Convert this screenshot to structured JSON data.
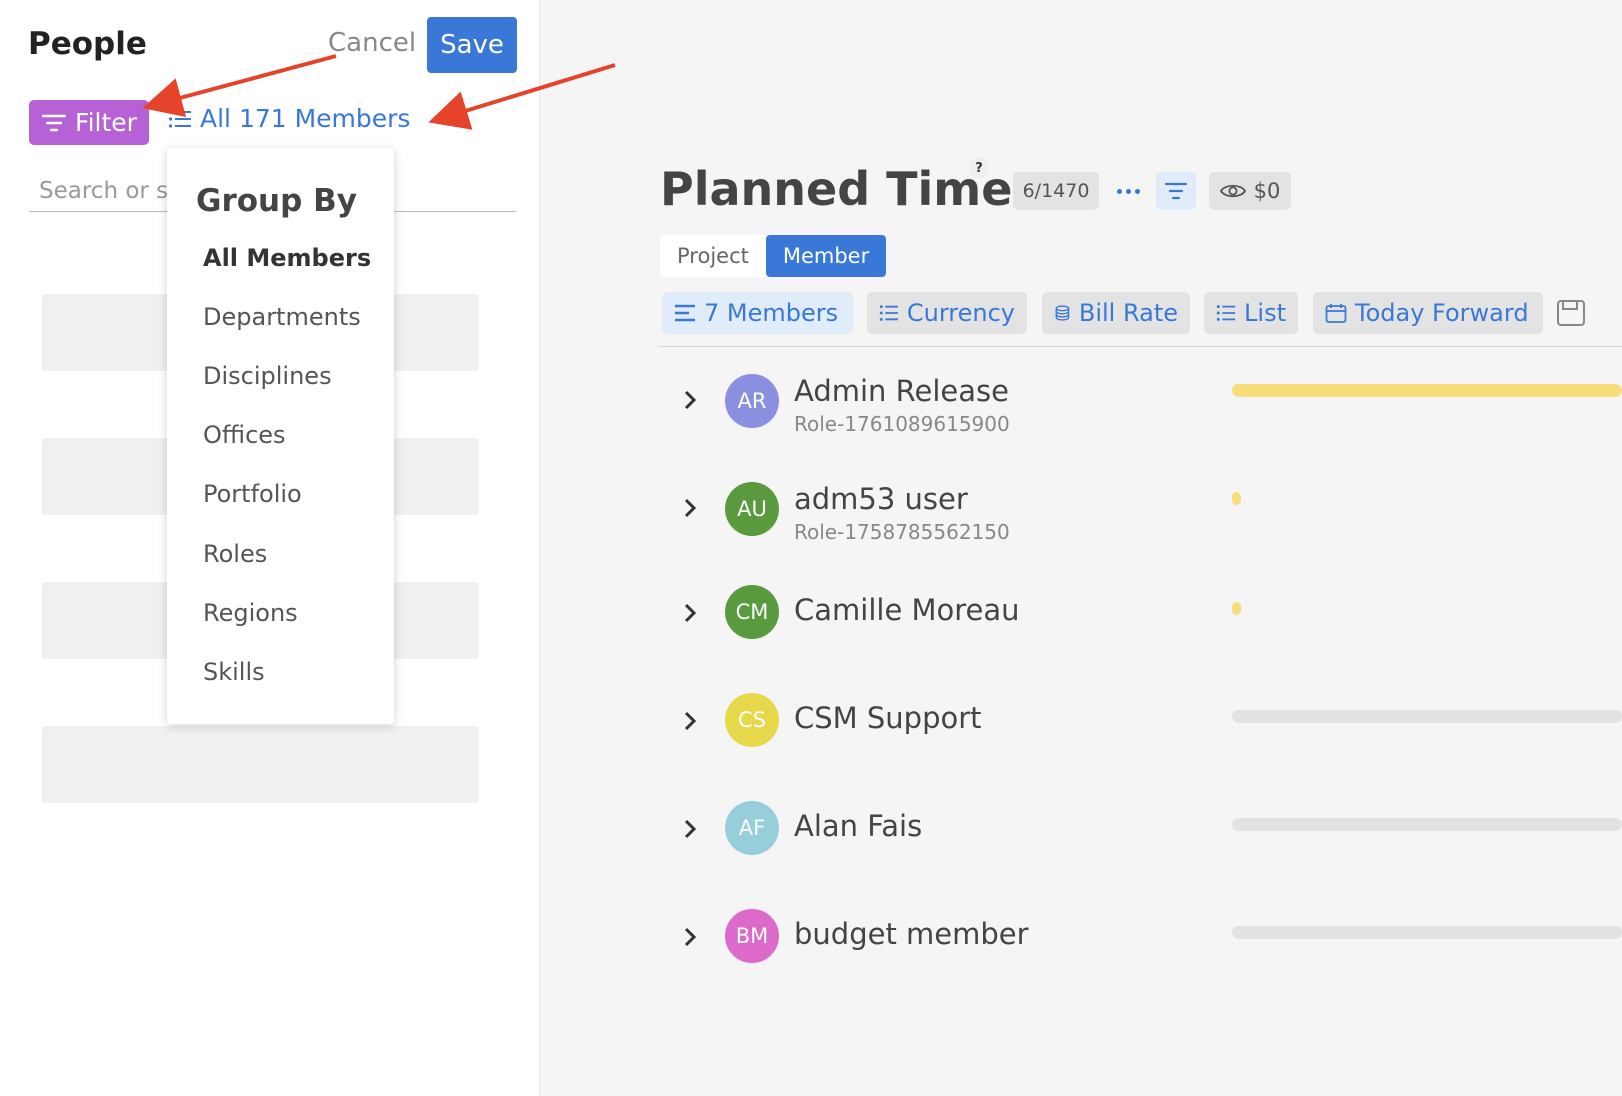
{
  "left_panel": {
    "title": "People",
    "cancel_label": "Cancel",
    "save_label": "Save",
    "filter_label": "Filter",
    "members_label": "All 171 Members",
    "search_placeholder": "Search or se"
  },
  "group_by": {
    "title": "Group By",
    "items": [
      "All Members",
      "Departments",
      "Disciplines",
      "Offices",
      "Portfolio",
      "Roles",
      "Regions",
      "Skills"
    ],
    "selected": "All Members"
  },
  "main": {
    "title": "Planned Time",
    "help": "?",
    "count": "6/1470",
    "cost": "$0",
    "tabs": [
      "Project",
      "Member"
    ],
    "active_tab": "Member",
    "toolbar": {
      "members": "7 Members",
      "currency": "Currency",
      "bill_rate": "Bill Rate",
      "list": "List",
      "today_forward": "Today Forward"
    }
  },
  "members": [
    {
      "initials": "AR",
      "name": "Admin Release",
      "role": "Role-1761089615900",
      "color": "#8a8fe0"
    },
    {
      "initials": "AU",
      "name": "adm53 user",
      "role": "Role-1758785562150",
      "color": "#5a9a3e"
    },
    {
      "initials": "CM",
      "name": "Camille Moreau",
      "role": "",
      "color": "#5a9a3e"
    },
    {
      "initials": "CS",
      "name": "CSM Support",
      "role": "",
      "color": "#e5d84a"
    },
    {
      "initials": "AF",
      "name": "Alan Fais",
      "role": "",
      "color": "#96cfdb"
    },
    {
      "initials": "BM",
      "name": "budget member",
      "role": "",
      "color": "#dc6ac8"
    }
  ],
  "colors": {
    "accent": "#3a78d8",
    "filter_purple": "#b662d6",
    "bar_yellow": "#f7de7a",
    "bar_gray": "#e2e2e2",
    "annotation_red": "#e5432a"
  }
}
